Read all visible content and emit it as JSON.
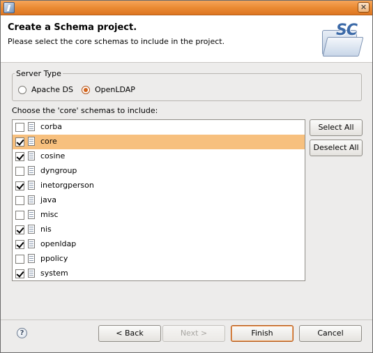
{
  "window": {
    "close_glyph": "✕",
    "app_icon": "eclipse-window-icon"
  },
  "header": {
    "title": "Create a Schema project.",
    "description": "Please select the core schemas to include in the project.",
    "banner_text": "SC"
  },
  "server_type": {
    "label": "Server Type",
    "options": [
      {
        "label": "Apache DS",
        "selected": false
      },
      {
        "label": "OpenLDAP",
        "selected": true
      }
    ]
  },
  "schemas": {
    "caption": "Choose the 'core' schemas to include:",
    "items": [
      {
        "name": "corba",
        "checked": false,
        "selected": false
      },
      {
        "name": "core",
        "checked": true,
        "selected": true
      },
      {
        "name": "cosine",
        "checked": true,
        "selected": false
      },
      {
        "name": "dyngroup",
        "checked": false,
        "selected": false
      },
      {
        "name": "inetorgperson",
        "checked": true,
        "selected": false
      },
      {
        "name": "java",
        "checked": false,
        "selected": false
      },
      {
        "name": "misc",
        "checked": false,
        "selected": false
      },
      {
        "name": "nis",
        "checked": true,
        "selected": false
      },
      {
        "name": "openldap",
        "checked": true,
        "selected": false
      },
      {
        "name": "ppolicy",
        "checked": false,
        "selected": false
      },
      {
        "name": "system",
        "checked": true,
        "selected": false
      }
    ]
  },
  "side_buttons": {
    "select_all": "Select All",
    "deselect_all": "Deselect All"
  },
  "footer": {
    "help_glyph": "?",
    "back": "< Back",
    "next": "Next >",
    "finish": "Finish",
    "cancel": "Cancel"
  },
  "colors": {
    "title_bar": "#ea8a33",
    "selection": "#f7c07e",
    "radio_accent": "#d4641b"
  }
}
